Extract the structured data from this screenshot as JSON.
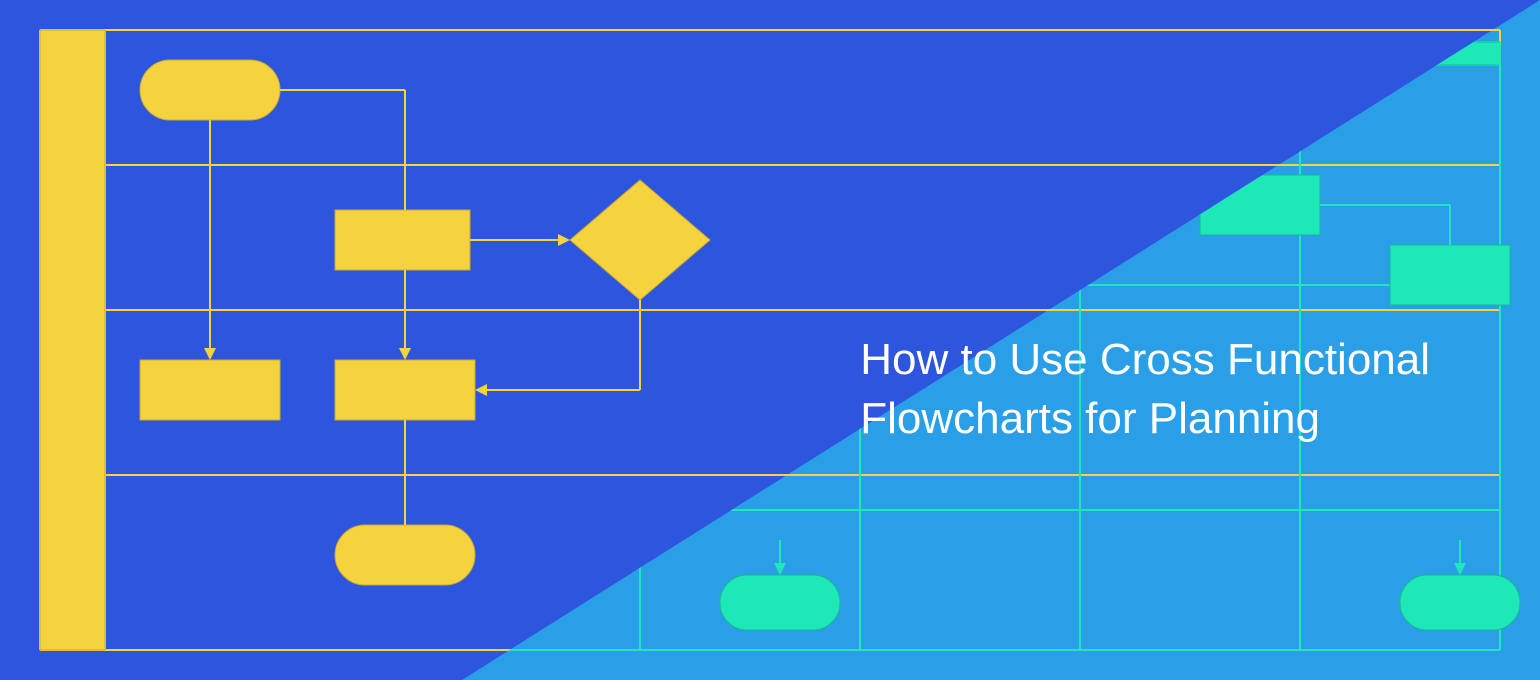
{
  "title_line1": "How to Use Cross Functional",
  "title_line2": "Flowcharts for Planning",
  "colors": {
    "bg_left": "#2E55DD",
    "bg_right": "#2A9FE8",
    "yellow": "#F5D33F",
    "yellow_stroke": "#C9A92F",
    "teal": "#1FE8B8",
    "teal_stroke": "#17B893"
  }
}
